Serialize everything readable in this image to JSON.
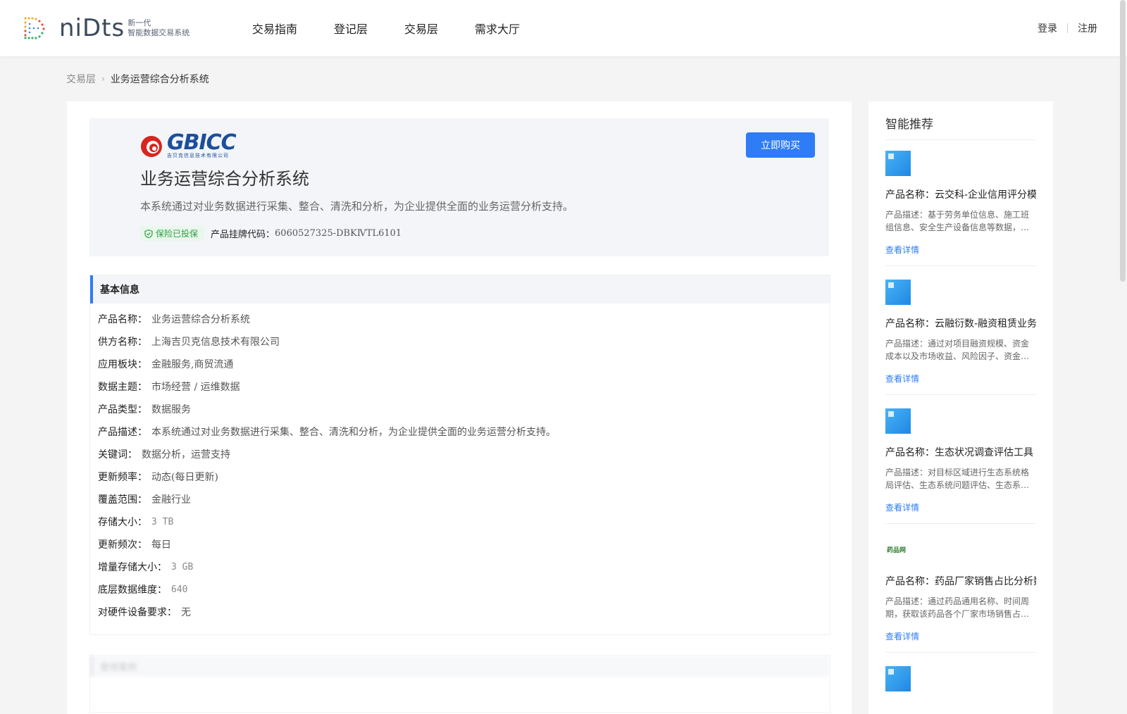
{
  "header": {
    "logo_word": "niDts",
    "logo_sub1": "新一代",
    "logo_sub2": "智能数据交易系统",
    "nav": [
      "交易指南",
      "登记层",
      "交易层",
      "需求大厅"
    ],
    "login": "登录",
    "register": "注册"
  },
  "breadcrumb": {
    "parent": "交易层",
    "current": "业务运营综合分析系统"
  },
  "product": {
    "brand_word": "GBICC",
    "brand_sub": "吉贝克信息技术有限公司",
    "buy_label": "立即购买",
    "title": "业务运营综合分析系统",
    "desc": "本系统通过对业务数据进行采集、整合、清洗和分析，为企业提供全面的业务运营分析支持。",
    "insurance_badge": "保险已投保",
    "code_label": "产品挂牌代码：",
    "code_value": "6060527325-DBKⅣTL6101"
  },
  "basic_info": {
    "heading": "基本信息",
    "rows": [
      {
        "k": "产品名称：",
        "v": "业务运营综合分析系统"
      },
      {
        "k": "供方名称：",
        "v": "上海吉贝克信息技术有限公司"
      },
      {
        "k": "应用板块：",
        "v": "金融服务,商贸流通"
      },
      {
        "k": "数据主题：",
        "v": "市场经营 / 运维数据"
      },
      {
        "k": "产品类型：",
        "v": "数据服务"
      },
      {
        "k": "产品描述：",
        "v": "本系统通过对业务数据进行采集、整合、清洗和分析，为企业提供全面的业务运营分析支持。"
      },
      {
        "k": "关键词：",
        "v": "数据分析，运营支持"
      },
      {
        "k": "更新频率：",
        "v": "动态(每日更新)"
      },
      {
        "k": "覆盖范围：",
        "v": "金融行业"
      },
      {
        "k": "存储大小：",
        "v": "3 TB"
      },
      {
        "k": "更新频次：",
        "v": "每日"
      },
      {
        "k": "增量存储大小：",
        "v": "3 GB"
      },
      {
        "k": "底层数据维度：",
        "v": "640"
      },
      {
        "k": "对硬件设备要求：",
        "v": "无"
      }
    ]
  },
  "next_section_heading": "使用案例",
  "sidebar": {
    "title": "智能推荐",
    "detail_label": "查看详情",
    "items": [
      {
        "name": "产品名称：云交科-企业信用评分模型",
        "desc": "产品描述：基于劳务单位信息、施工班组信息、安全生产设备信息等数据，…"
      },
      {
        "name": "产品名称：云融衍数-融资租赁业务分析",
        "desc": "产品描述：通过对项目融资规模、资金成本以及市场收益、风险因子、资金…"
      },
      {
        "name": "产品名称：生态状况调查评估工具",
        "desc": "产品描述：对目标区域进行生态系统格局评估、生态系统问题评估、生态系…"
      },
      {
        "name": "产品名称：药品厂家销售占比分析数据",
        "desc": "产品描述：通过药品通用名称、时间周期，获取该药品各个厂家市场销售占…",
        "logo_text": "药品网"
      }
    ]
  }
}
